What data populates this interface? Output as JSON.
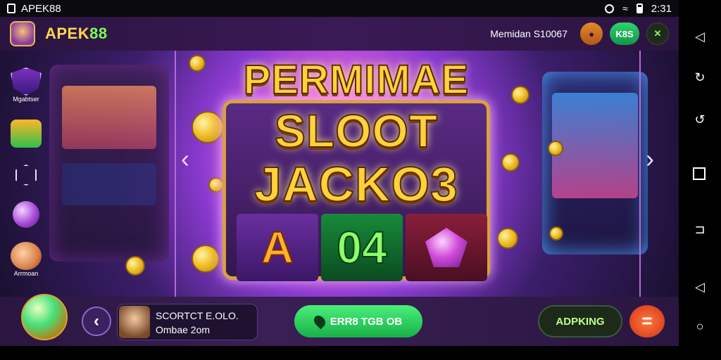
{
  "status_bar": {
    "app_name": "APEK88",
    "time": "2:31"
  },
  "header": {
    "brand_main": "APEK",
    "brand_num": "88",
    "user_label": "Memidan S10067",
    "btn_green": "K8S"
  },
  "banner": {
    "title_line1": "PERMIMAE",
    "title_line2": "SLOOT",
    "title_line3": "JACKO3",
    "reel_a": "A",
    "reel_b": "04"
  },
  "sidebar": {
    "items": [
      {
        "label": "Mgabtser",
        "icon": "shield-icon"
      },
      {
        "label": "",
        "icon": "dice-icon"
      },
      {
        "label": "",
        "icon": "hexagon-icon"
      },
      {
        "label": "",
        "icon": "orb-icon"
      },
      {
        "label": "Arrmoan",
        "icon": "hand-icon"
      }
    ]
  },
  "bottom_bar": {
    "user_line1": "SCORTCT E.OLO.",
    "user_line2": "Ombae 2om",
    "play_label": "ERR8 TGB OB",
    "action_label": "ADPKING",
    "menu_symbol": "="
  },
  "colors": {
    "accent_gold": "#ffd84a",
    "accent_green": "#2fd36b",
    "bg_purple": "#3a1a55"
  }
}
